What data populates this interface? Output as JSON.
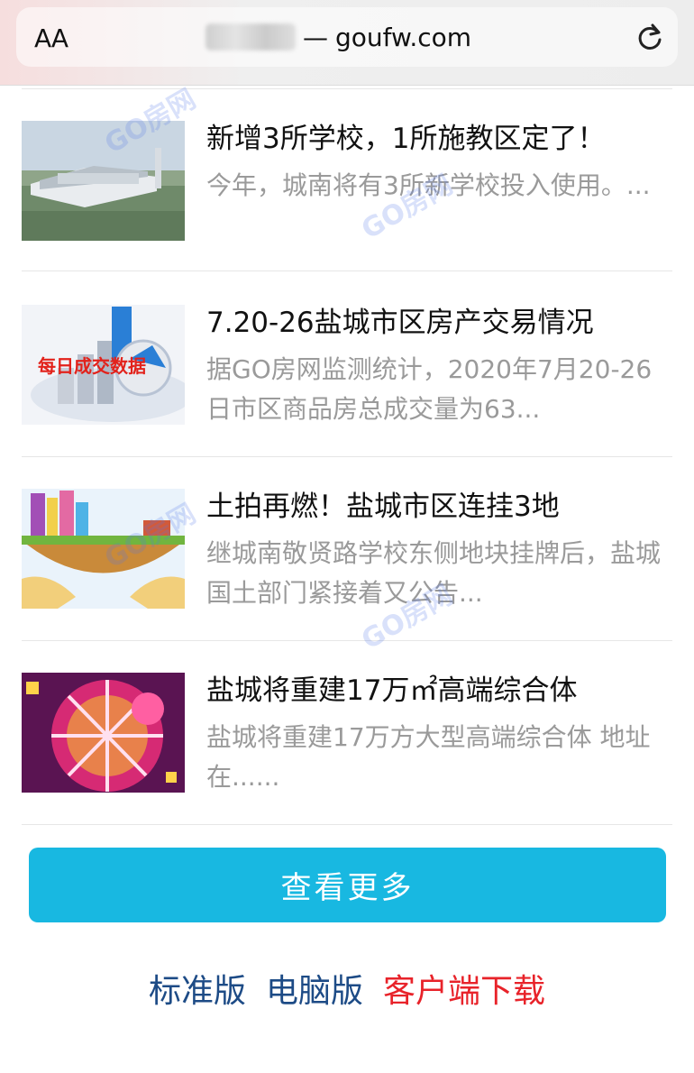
{
  "browser": {
    "text_size_label": "AA",
    "url_prefix_blurred": true,
    "url_separator": "—",
    "url": "goufw.com",
    "reload_icon": "reload-icon"
  },
  "articles": [
    {
      "title": "新增3所学校，1所施教区定了！",
      "summary": "今年，城南将有3所新学校投入使用。...",
      "thumb": "school-aerial-photo"
    },
    {
      "title": "7.20-26盐城市区房产交易情况",
      "summary": "据GO房网监测统计，2020年7月20-26日市区商品房总成交量为63...",
      "thumb_label": "每日成交数据"
    },
    {
      "title": "土拍再燃！盐城市区连挂3地",
      "summary": "继城南敬贤路学校东侧地块挂牌后，盐城国土部门紧接着又公告...",
      "thumb": "hands-holding-land"
    },
    {
      "title": "盐城将重建17万㎡高端综合体",
      "summary": "盐城将重建17万方大型高端综合体 地址在......",
      "thumb": "shopping-globe"
    }
  ],
  "watermark_text": "GO房网",
  "more_button": "查看更多",
  "footer": {
    "standard": "标准版",
    "desktop": "电脑版",
    "app_download": "客户端下载"
  },
  "colors": {
    "accent_button": "#18b8e1",
    "footer_link": "#1d4b86",
    "footer_app_link": "#e8232a"
  }
}
